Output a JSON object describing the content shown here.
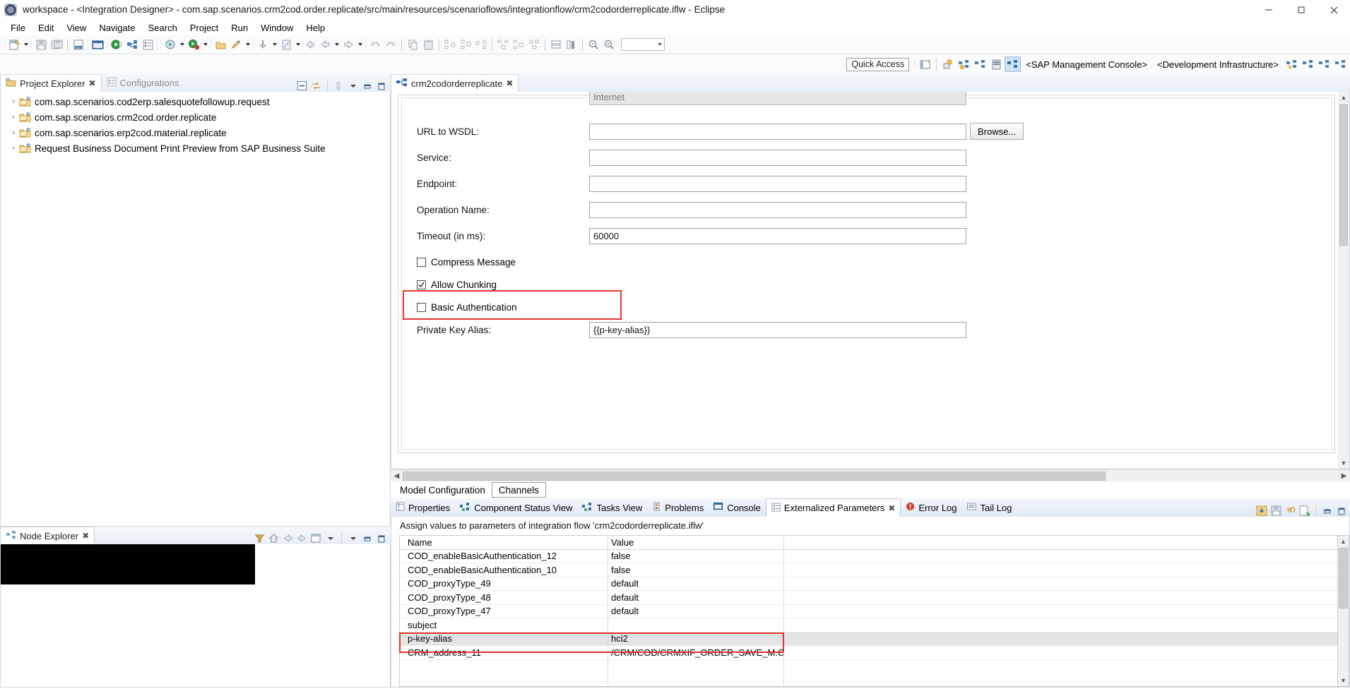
{
  "window": {
    "title": "workspace - <Integration Designer> - com.sap.scenarios.crm2cod.order.replicate/src/main/resources/scenarioflows/integrationflow/crm2codorderreplicate.iflw - Eclipse",
    "icon": "eclipse-icon",
    "minimize_label": "─",
    "maximize_label": "❐",
    "close_label": "✕"
  },
  "menubar": {
    "items": [
      {
        "label": "File"
      },
      {
        "label": "Edit"
      },
      {
        "label": "View"
      },
      {
        "label": "Navigate"
      },
      {
        "label": "Search"
      },
      {
        "label": "Project"
      },
      {
        "label": "Run"
      },
      {
        "label": "Window"
      },
      {
        "label": "Help"
      }
    ]
  },
  "toolbar": {
    "zoom_combo_value": ""
  },
  "quick_access": {
    "label": "Quick Access",
    "perspectives": [
      {
        "label": "<SAP Management Console>"
      },
      {
        "label": "<Development Infrastructure>"
      }
    ]
  },
  "left_panel": {
    "tabs": [
      {
        "label": "Project Explorer",
        "icon": "project-explorer-icon",
        "selected": true,
        "close": "✖"
      },
      {
        "label": "Configurations",
        "icon": "configurations-icon",
        "selected": false
      }
    ],
    "tree": [
      {
        "label": "com.sap.scenarios.cod2erp.salesquotefollowup.request",
        "icon": "folder-icon",
        "expander": "›"
      },
      {
        "label": "com.sap.scenarios.crm2cod.order.replicate",
        "icon": "folder-icon",
        "expander": "›"
      },
      {
        "label": "com.sap.scenarios.erp2cod.material.replicate",
        "icon": "folder-icon",
        "expander": "›"
      },
      {
        "label": "Request Business Document Print Preview from SAP Business Suite",
        "icon": "folder-icon",
        "expander": "›"
      }
    ]
  },
  "node_explorer": {
    "tabs": [
      {
        "label": "Node Explorer",
        "icon": "node-explorer-icon",
        "selected": true,
        "close": "✖"
      }
    ]
  },
  "editor": {
    "tabs": [
      {
        "label": "crm2codorderreplicate",
        "icon": "iflow-icon",
        "selected": true,
        "close": "✖"
      }
    ],
    "fields": [
      {
        "label": "",
        "value": "Internet",
        "type": "combo-clipped",
        "disabled": true
      },
      {
        "label": "URL to WSDL:",
        "value": "",
        "type": "text",
        "button": "Browse..."
      },
      {
        "label": "Service:",
        "value": "",
        "type": "text"
      },
      {
        "label": "Endpoint:",
        "value": "",
        "type": "text"
      },
      {
        "label": "Operation Name:",
        "value": "",
        "type": "text"
      },
      {
        "label": "Timeout (in ms):",
        "value": "60000",
        "type": "text"
      }
    ],
    "checkboxes": [
      {
        "label": "Compress Message",
        "checked": false
      },
      {
        "label": "Allow Chunking",
        "checked": true
      },
      {
        "label": "Basic Authentication",
        "checked": false,
        "highlighted": true
      }
    ],
    "private_key_alias": {
      "label": "Private Key Alias:",
      "value": "{{p-key-alias}}"
    },
    "model_tabs": [
      {
        "label": "Model Configuration",
        "selected": false
      },
      {
        "label": "Channels",
        "selected": true
      }
    ]
  },
  "bottom_panel": {
    "tabs": [
      {
        "label": "Properties",
        "icon": "properties-icon",
        "selected": false
      },
      {
        "label": "Component Status View",
        "icon": "component-status-icon",
        "selected": false
      },
      {
        "label": "Tasks View",
        "icon": "tasks-icon",
        "selected": false
      },
      {
        "label": "Problems",
        "icon": "problems-icon",
        "selected": false
      },
      {
        "label": "Console",
        "icon": "console-icon",
        "selected": false
      },
      {
        "label": "Externalized Parameters",
        "icon": "externalized-parameters-icon",
        "selected": true,
        "close": "✖"
      },
      {
        "label": "Error Log",
        "icon": "error-log-icon",
        "selected": false
      },
      {
        "label": "Tail Log",
        "icon": "tail-log-icon",
        "selected": false
      }
    ],
    "description": "Assign values to parameters of integration flow 'crm2codorderreplicate.iflw'",
    "table": {
      "columns": [
        "Name",
        "Value"
      ],
      "rows": [
        {
          "name": "COD_enableBasicAuthentication_12",
          "value": "false",
          "selected": false
        },
        {
          "name": "COD_enableBasicAuthentication_10",
          "value": "false",
          "selected": false
        },
        {
          "name": "COD_proxyType_49",
          "value": "default",
          "selected": false
        },
        {
          "name": "COD_proxyType_48",
          "value": "default",
          "selected": false
        },
        {
          "name": "COD_proxyType_47",
          "value": "default",
          "selected": false
        },
        {
          "name": "subject",
          "value": "",
          "selected": false
        },
        {
          "name": "p-key-alias",
          "value": "hci2",
          "selected": true,
          "highlighted": true
        },
        {
          "name": "CRM_address_11",
          "value": "/CRM/COD/CRMXIF_ORDER_SAVE_M.CR...",
          "selected": false
        }
      ]
    }
  },
  "colors": {
    "highlight_red": "#e5352b",
    "tab_selected_bg": "#ffffff",
    "selection_gray": "#e4e4e4",
    "perspective_active": "#cfe2f6"
  }
}
